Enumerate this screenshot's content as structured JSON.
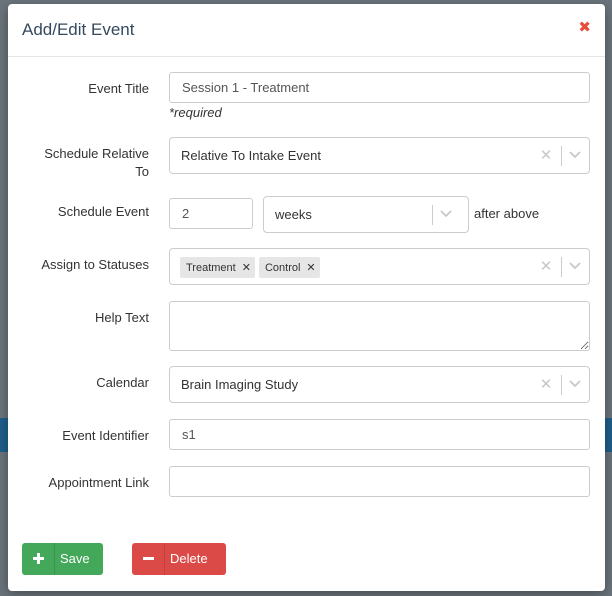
{
  "modal": {
    "title": "Add/Edit Event",
    "close_icon": "close-icon"
  },
  "form": {
    "event_title": {
      "label": "Event Title",
      "value": "Session 1 - Treatment",
      "hint": "*required"
    },
    "schedule_relative": {
      "label": "Schedule Relative To",
      "label_line1": "Schedule Relative",
      "label_line2": "To",
      "value": "Relative To Intake Event"
    },
    "schedule_event": {
      "label": "Schedule Event",
      "amount": "2",
      "unit": "weeks",
      "suffix": "after above"
    },
    "statuses": {
      "label": "Assign to Statuses",
      "tags": [
        "Treatment",
        "Control"
      ]
    },
    "help_text": {
      "label": "Help Text",
      "value": ""
    },
    "calendar": {
      "label": "Calendar",
      "value": "Brain Imaging Study"
    },
    "event_identifier": {
      "label": "Event Identifier",
      "value": "s1"
    },
    "appointment_link": {
      "label": "Appointment Link",
      "value": ""
    }
  },
  "buttons": {
    "save": "Save",
    "delete": "Delete"
  },
  "colors": {
    "save": "#43a85a",
    "delete": "#dc4a48",
    "close": "#e74c3c",
    "title": "#34495e"
  }
}
